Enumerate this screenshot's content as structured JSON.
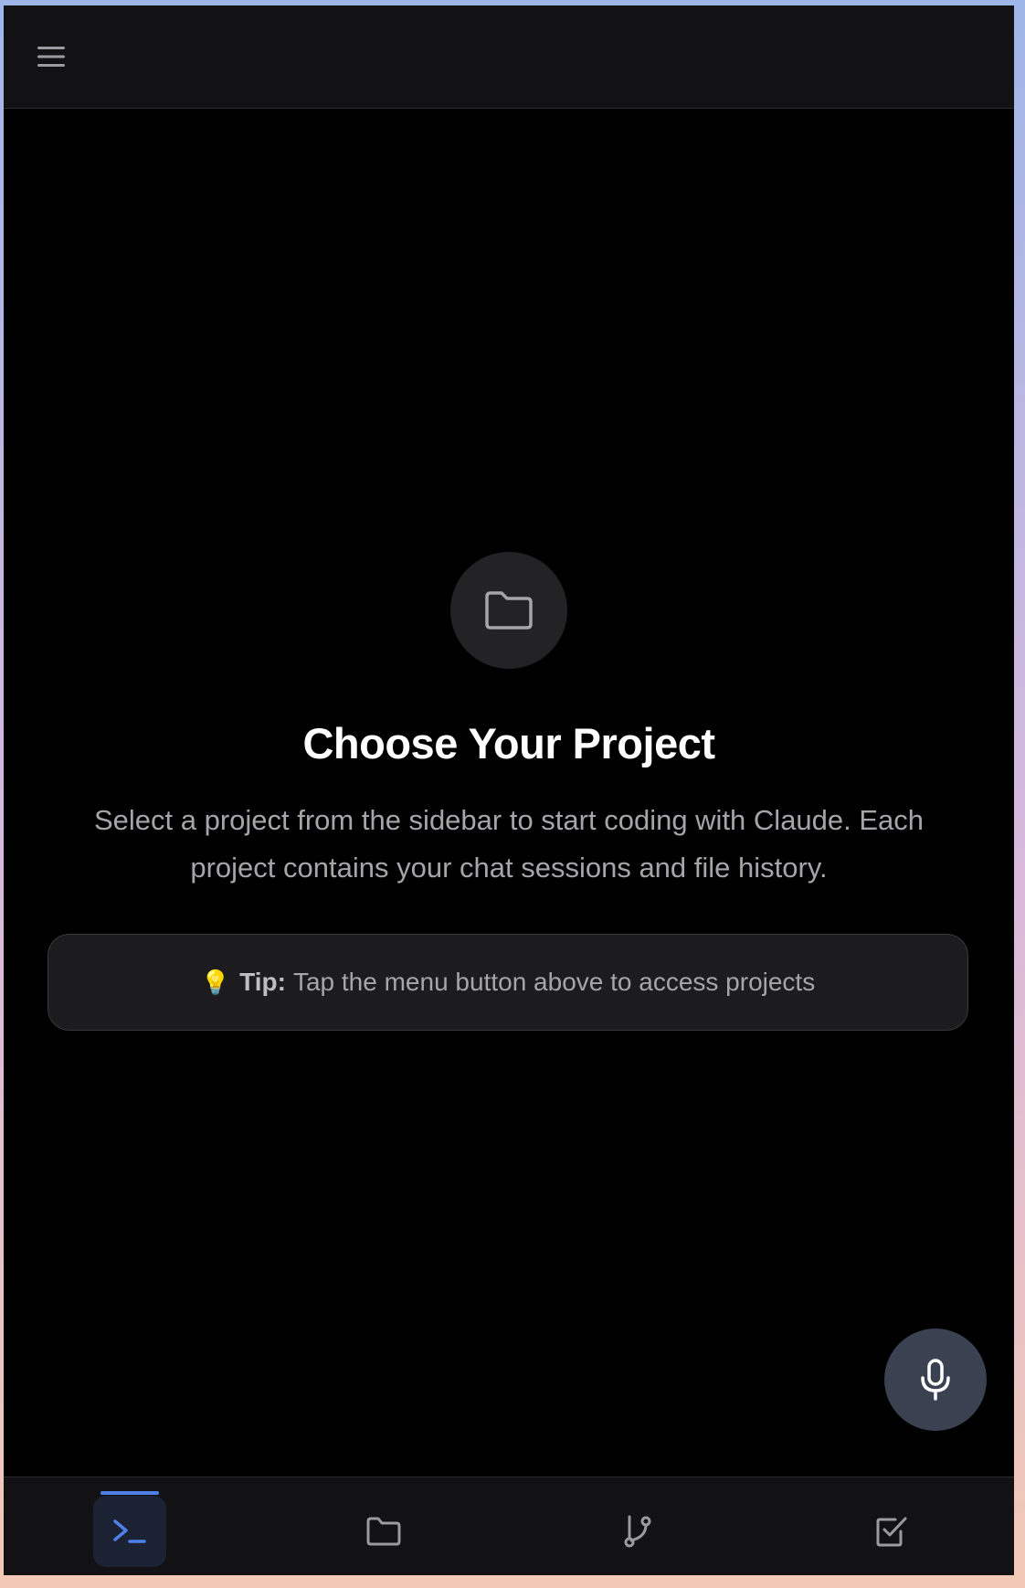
{
  "header": {
    "menu_icon": "hamburger-menu-icon"
  },
  "empty_state": {
    "icon": "folder-icon",
    "title": "Choose Your Project",
    "description": "Select a project from the sidebar to start coding with Claude. Each project contains your chat sessions and file history.",
    "tip": {
      "icon": "💡",
      "label": "Tip:",
      "text": "Tap the menu button above to access projects"
    }
  },
  "mic_button": {
    "icon": "microphone-icon"
  },
  "bottom_nav": {
    "items": [
      {
        "icon": "terminal-icon",
        "active": true
      },
      {
        "icon": "folder-icon",
        "active": false
      },
      {
        "icon": "git-branch-icon",
        "active": false
      },
      {
        "icon": "checkbox-icon",
        "active": false
      }
    ]
  },
  "colors": {
    "background": "#000000",
    "bar": "#121214",
    "accent": "#4f7fe8",
    "mic": "#3a4150",
    "text_secondary": "#a5a5aa"
  }
}
